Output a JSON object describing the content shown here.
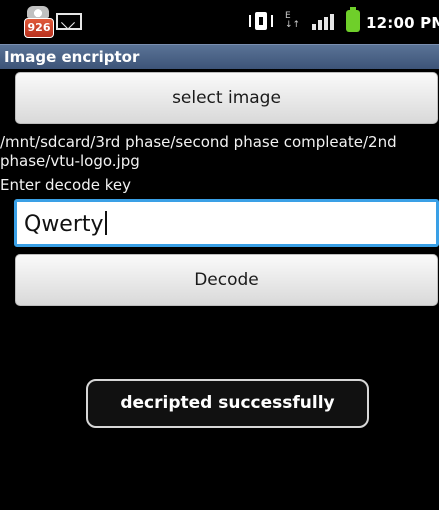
{
  "status_bar": {
    "notification_badge": "926",
    "time": "12:00 PM",
    "icons": [
      "notification-badge-icon",
      "mail-icon",
      "vibrate-icon",
      "data-transfer-icon",
      "signal-icon",
      "battery-icon"
    ],
    "battery_color": "#6fcf2a"
  },
  "app": {
    "title": "Image encriptor"
  },
  "main": {
    "select_button_label": "select image",
    "file_path": "/mnt/sdcard/3rd phase/second phase compleate/2nd phase/vtu-logo.jpg",
    "key_label": "Enter decode key",
    "key_value": "Qwerty",
    "decode_button_label": "Decode"
  },
  "toast": {
    "message": "decripted successfully"
  },
  "colors": {
    "title_bar": "#4a6287",
    "focus_border": "#3aa0e6",
    "background": "#000000"
  }
}
